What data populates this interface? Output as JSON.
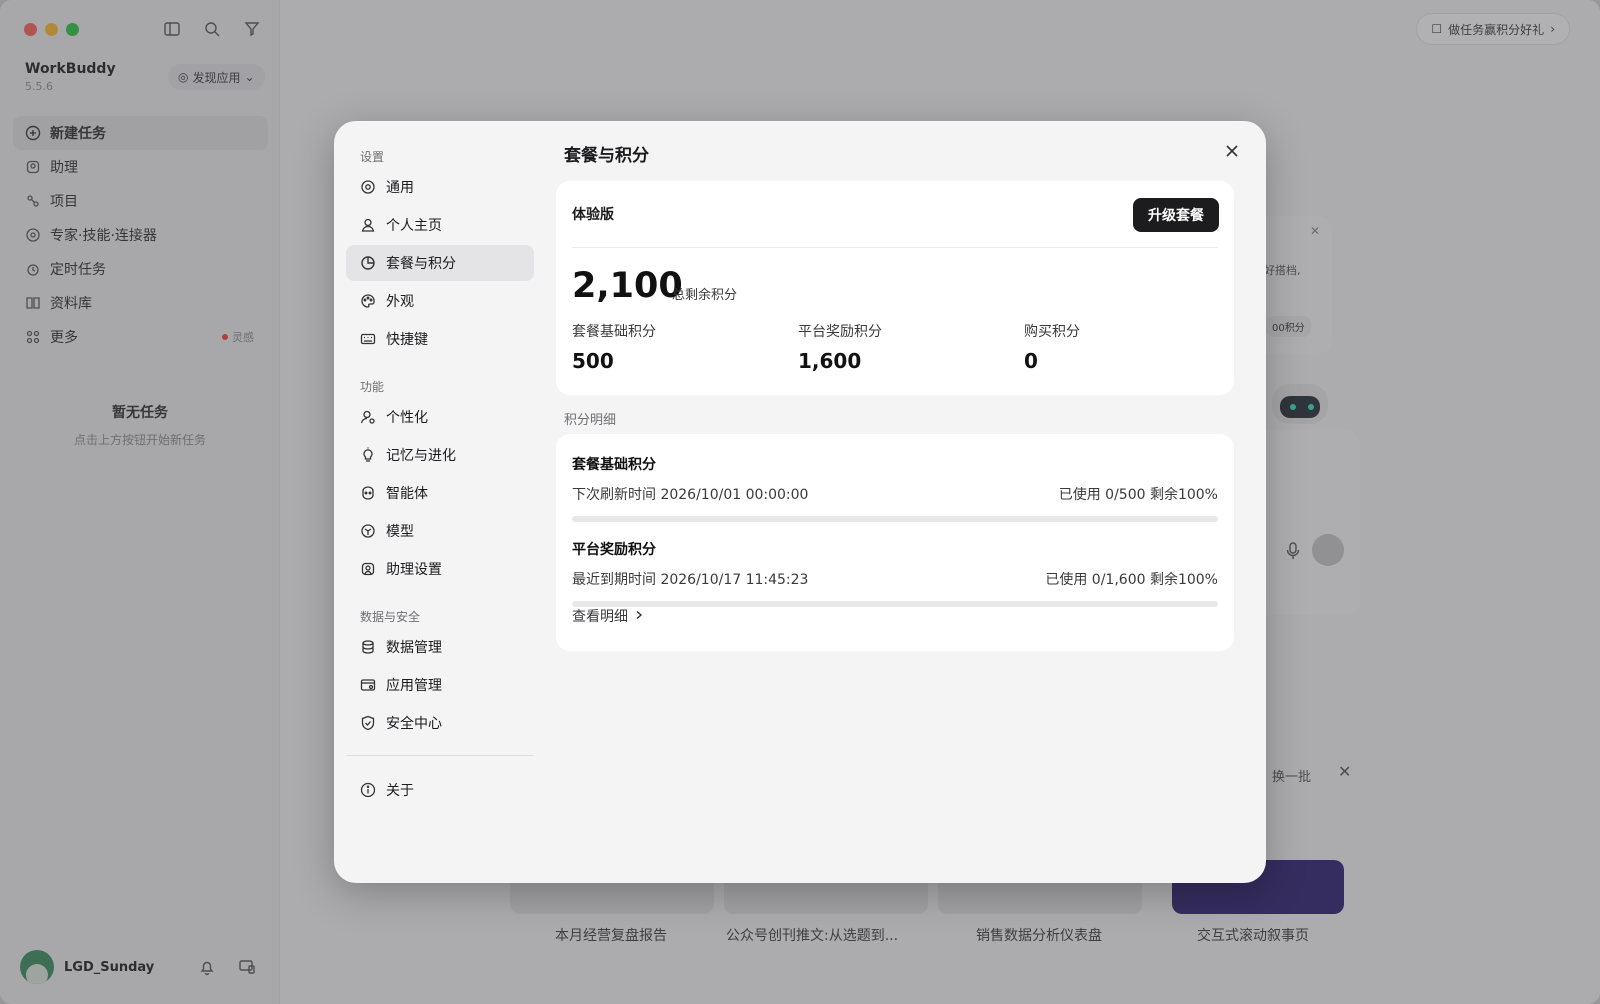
{
  "sidebar": {
    "brand": "WorkBuddy",
    "version": "5.5.6",
    "discover_label": "发现应用",
    "items": [
      {
        "label": "新建任务"
      },
      {
        "label": "助理"
      },
      {
        "label": "项目"
      },
      {
        "label": "专家·技能·连接器"
      },
      {
        "label": "定时任务"
      },
      {
        "label": "资料库"
      },
      {
        "label": "更多",
        "badge": "灵感"
      }
    ],
    "empty_title": "暂无任务",
    "empty_sub": "点击上方按钮开始新任务",
    "user_name": "LGD_Sunday"
  },
  "main": {
    "promo_label": "做任务赢积分好礼",
    "card_text": "好搭档,",
    "card_pill": "00积分",
    "refresh_label": "换一批",
    "thumbnails": [
      "本月经营复盘报告",
      "公众号创刊推文:从选题到...",
      "销售数据分析仪表盘",
      "交互式滚动叙事页"
    ]
  },
  "modal": {
    "title": "套餐与积分",
    "groups": {
      "settings": "设置",
      "features": "功能",
      "data_security": "数据与安全"
    },
    "nav": {
      "general": "通用",
      "profile": "个人主页",
      "plan": "套餐与积分",
      "appearance": "外观",
      "shortcuts": "快捷键",
      "personalize": "个性化",
      "memory": "记忆与进化",
      "agent": "智能体",
      "model": "模型",
      "assistant_settings": "助理设置",
      "data_mgmt": "数据管理",
      "app_mgmt": "应用管理",
      "security": "安全中心",
      "about": "关于"
    },
    "plan": {
      "name": "体验版",
      "upgrade_label": "升级套餐",
      "total_points": "2,100",
      "total_label": "总剩余积分",
      "stats": [
        {
          "label": "套餐基础积分",
          "value": "500"
        },
        {
          "label": "平台奖励积分",
          "value": "1,600"
        },
        {
          "label": "购买积分",
          "value": "0"
        }
      ]
    },
    "detail": {
      "section_label": "积分明细",
      "rows": [
        {
          "title": "套餐基础积分",
          "sub": "下次刷新时间 2026/10/01 00:00:00",
          "usage": "已使用 0/500 剩余100%",
          "used_fraction": 0
        },
        {
          "title": "平台奖励积分",
          "sub": "最近到期时间 2026/10/17 11:45:23",
          "usage": "已使用 0/1,600 剩余100%",
          "used_fraction": 0
        }
      ],
      "link_label": "查看明细"
    }
  }
}
